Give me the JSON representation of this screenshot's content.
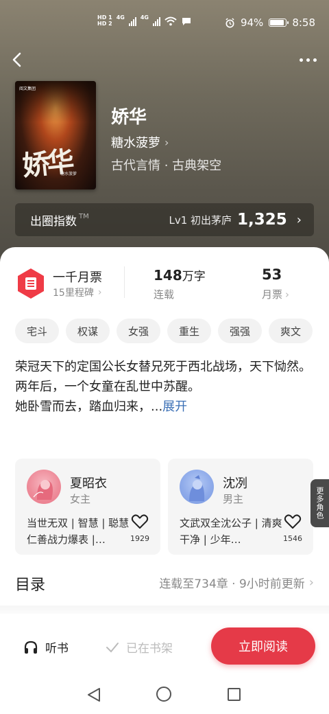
{
  "status_bar": {
    "sim1": "HD 1",
    "sim2": "HD 2",
    "net1": "4G",
    "net2": "4G",
    "battery_text": "94%",
    "battery_level": 0.94,
    "time": "8:58"
  },
  "book": {
    "title": "娇华",
    "author": "糖水菠萝",
    "genre": "古代言情 · 古典架空",
    "cover_title": "娇华",
    "cover_publisher": "阅文集团",
    "cover_author": "糖水菠萝"
  },
  "index_bar": {
    "label": "出圈指数",
    "tm": "TM",
    "level": "Lv1 初出茅庐",
    "value": "1,325"
  },
  "stats": {
    "ticket_title": "一千月票",
    "ticket_sub": "15里程碑",
    "words_value": "148",
    "words_unit": "万字",
    "words_label": "连载",
    "monthly_value": "53",
    "monthly_label": "月票"
  },
  "tags": [
    "宅斗",
    "权谋",
    "女强",
    "重生",
    "强强",
    "爽文"
  ],
  "synopsis": {
    "line1": "荣冠天下的定国公长女替兄死于西北战场，天下恸然。",
    "line2": "两年后，一个女童在乱世中苏醒。",
    "line3": "她卧雪而去，踏血归来，...",
    "expand": "展开"
  },
  "characters": [
    {
      "name": "夏昭衣",
      "role": "女主",
      "desc": "当世无双 | 智慧 | 聪慧仁善战力爆表 |…",
      "likes": "1929"
    },
    {
      "name": "沈冽",
      "role": "男主",
      "desc": "文武双全沈公子 | 清爽干净 | 少年…",
      "likes": "1546"
    }
  ],
  "more_roles": "更多角色",
  "toc": {
    "title": "目录",
    "info": "连载至734章 · 9小时前更新"
  },
  "actions": {
    "listen": "听书",
    "shelved": "已在书架",
    "read": "立即阅读"
  },
  "colors": {
    "accent": "#e53a48",
    "link": "#3a6fb5"
  }
}
